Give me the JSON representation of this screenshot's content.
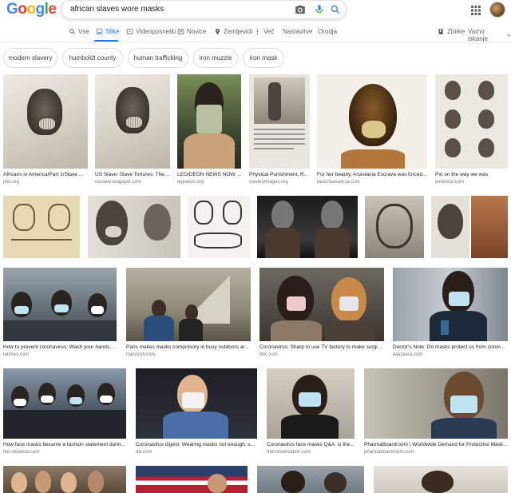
{
  "logo": {
    "letters": [
      "G",
      "o",
      "o",
      "g",
      "l",
      "e"
    ],
    "colors": [
      "#4285f4",
      "#ea4335",
      "#fbbc05",
      "#4285f4",
      "#34a853",
      "#ea4335"
    ]
  },
  "search": {
    "query": "african slaves wore masks"
  },
  "icons": {
    "camera": "camera-icon",
    "mic": "mic-icon",
    "search": "search-icon",
    "apps": "apps-icon"
  },
  "tabs": [
    {
      "label": "Vse",
      "icon": "search-icon"
    },
    {
      "label": "Slike",
      "icon": "image-icon",
      "active": true
    },
    {
      "label": "Videoposnetki",
      "icon": "video-icon"
    },
    {
      "label": "Novice",
      "icon": "news-icon"
    },
    {
      "label": "Zemljevidi",
      "icon": "map-pin-icon"
    },
    {
      "label": "Več",
      "icon": "more-icon"
    },
    {
      "label": "Nastavitve"
    },
    {
      "label": "Orodja"
    }
  ],
  "right_tabs": {
    "collections": "Zbirke",
    "safesearch": "Varno iskanje"
  },
  "chips": [
    "modern slavery",
    "humboldt county",
    "human trafficking",
    "iron muzzle",
    "iron mask"
  ],
  "results": [
    {
      "caption": "Africans in America/Part 1/Slave ...",
      "source": "pbs.org"
    },
    {
      "caption": "US Slave: Slave Tortures: The ...",
      "source": "usslave.blogspot.com"
    },
    {
      "caption": "LEGIDEON NEWS NOW ...",
      "source": "legideon.org"
    },
    {
      "caption": "Physical Punishment, R...",
      "source": "slaveryimages.org"
    },
    {
      "caption": "For her beauty, Anastacia Escrava was forced...",
      "source": "face2faceafrica.com"
    },
    {
      "caption": "Pin on the way we was",
      "source": "pinterest.com"
    },
    {
      "caption": "How to prevent coronavirus: Wash your hands, ...",
      "source": "latimes.com"
    },
    {
      "caption": "Paris makes masks compulsory in busy outdoors ar...",
      "source": "france24.com"
    },
    {
      "caption": "Coronavirus: Sharp to use TV factory to make surgic...",
      "source": "bbc.com"
    },
    {
      "caption": "Doctor's Note: Do masks protect us from coron...",
      "source": "aljazeera.com"
    },
    {
      "caption": "How face masks became a fashion statement durin...",
      "source": "the-slovenia.com"
    },
    {
      "caption": "Coronavirus digest: Wearing masks not enough, s...",
      "source": "dw.com"
    },
    {
      "caption": "Coronavirus face masks Q&A: is the...",
      "source": "theconversation.com"
    },
    {
      "caption": "PharmaBoardroom | Worldwide Demand for Protective Mask...",
      "source": "pharmaboardroom.com"
    }
  ]
}
